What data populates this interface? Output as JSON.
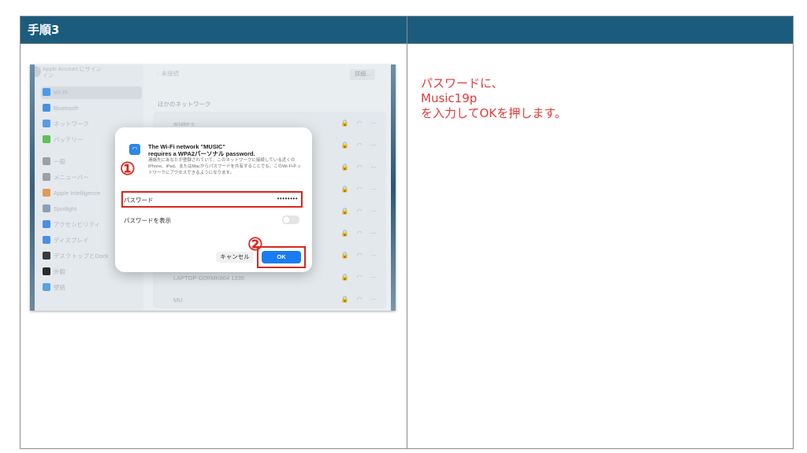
{
  "header": {
    "title": "手順3"
  },
  "instruction": {
    "lines": [
      "パスワードに、",
      "Music19p",
      "を入力してOKを押します。"
    ]
  },
  "screenshot": {
    "sidebar": {
      "account": [
        "Apple Account にサイン",
        "イン"
      ],
      "items": [
        {
          "label": "Wi-Fi",
          "color": "#4a9ae8"
        },
        {
          "label": "Bluetooth",
          "color": "#4a8fe0"
        },
        {
          "label": "ネットワーク",
          "color": "#5b9be6"
        },
        {
          "label": "バッテリー",
          "color": "#5fbf5a"
        },
        {
          "label": "一般",
          "color": "#9aa1a7"
        },
        {
          "label": "メニューバー",
          "color": "#9aa1a7"
        },
        {
          "label": "Apple Intelligence",
          "color": "#e09a5a"
        },
        {
          "label": "Spotlight",
          "color": "#8aa0b8"
        },
        {
          "label": "アクセシビリティ",
          "color": "#4a8fe0"
        },
        {
          "label": "ディスプレイ",
          "color": "#4a8fe0"
        },
        {
          "label": "デスクトップとDock",
          "color": "#3a3a3a"
        },
        {
          "label": "外観",
          "color": "#2b2b2b"
        },
        {
          "label": "壁紙",
          "color": "#5aa0e0"
        }
      ]
    },
    "main": {
      "status": "未接続",
      "detail_button": "詳細...",
      "other_networks": "ほかのネットワーク",
      "networks": [
        "ariake-s",
        "",
        "",
        "",
        "",
        "",
        "",
        "LAPTOP-G0RMK864 1335",
        "MU"
      ],
      "row_icons": "🔒 ◠ ⋯"
    },
    "dialog": {
      "title_line1": "The Wi-Fi network \"MUSIC\"",
      "title_line2": "requires a WPA2パーソナル password.",
      "body": "連絡先にあなたが登録されていて、このネットワークに接続している近くのiPhone、iPad、またはMacからパスワードを共有することでも、このWi-Fiネットワークにアクセスできるようになります。",
      "password_label": "パスワード",
      "password_value": "••••••••",
      "show_password_label": "パスワードを表示",
      "cancel_label": "キャンセル",
      "ok_label": "OK",
      "marker1": "①",
      "marker2": "②"
    }
  },
  "colors": {
    "header_bg": "#1b5c7d",
    "instruction_text": "#e03b3b",
    "highlight": "#d9261c",
    "ok_button": "#1a7cf0"
  }
}
